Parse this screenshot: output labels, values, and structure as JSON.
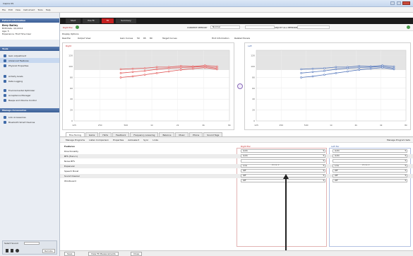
{
  "window": {
    "title": "Inspire OS"
  },
  "menu": [
    "File",
    "Edit",
    "View",
    "Instrument",
    "Tools",
    "Help"
  ],
  "sidebar": {
    "patient_header": "Patient Information",
    "patient_name": "Brey Bailey",
    "patient_lines": [
      "Birthdate: 4/1/2014",
      "Age: 5",
      "Experience: First Time User"
    ],
    "tools_header": "Tools",
    "tools": [
      "Gain Adjustment",
      "Advanced Features",
      "Physical Properties",
      "Activity Goals",
      "Data Logging",
      "Environmental Optimizer",
      "Acceptance Manager",
      "Beeps and Volume Control"
    ],
    "active_tool_index": 1,
    "manage_header": "Manage Accessories",
    "manage": [
      "Link Accessories",
      "Bluetooth Smart Devices"
    ],
    "footer_status": "Select Sound",
    "footer_badge": "Remote"
  },
  "topnav": {
    "tabs": [
      "Start",
      "Pre-Fit",
      "Fit",
      "Summary"
    ],
    "active_index": 2
  },
  "toolbar": {
    "label_left": "Right Ear",
    "label_mid": "CURRENT MEMORY",
    "memory_value": "Normal",
    "label_right": "ADJUST ALL MEMORIES",
    "row2": [
      "Display Options",
      "Real Ear",
      "Output View"
    ],
    "row3": [
      "Gain Curves",
      "50",
      "65",
      "80",
      "Target Curves",
      "Hint Information",
      "Related Panels"
    ]
  },
  "charts": {
    "right": {
      "ear": "right",
      "color": "#e05555",
      "toggle": "Right"
    },
    "left": {
      "ear": "left",
      "color": "#5577bb",
      "toggle": "Left"
    },
    "y_ticks": [
      "120",
      "100",
      "80",
      "60",
      "40",
      "20",
      "0"
    ],
    "x_ticks": [
      "125",
      "250",
      "500",
      "1k",
      "2k",
      "4k",
      "8k"
    ]
  },
  "chart_data": {
    "type": "line",
    "x": [
      "250",
      "500",
      "750",
      "1k",
      "1.5k",
      "2k",
      "3k",
      "4k",
      "6k"
    ],
    "series": [
      {
        "ear": "right",
        "values": [
          95,
          96,
          97,
          99,
          99,
          101,
          100,
          102,
          100
        ]
      },
      {
        "ear": "right",
        "values": [
          88,
          90,
          92,
          95,
          97,
          98,
          99,
          100,
          97
        ]
      },
      {
        "ear": "right",
        "values": [
          80,
          82,
          85,
          88,
          91,
          94,
          96,
          98,
          95
        ]
      },
      {
        "ear": "left",
        "values": [
          95,
          96,
          97,
          99,
          99,
          101,
          100,
          102,
          100
        ]
      },
      {
        "ear": "left",
        "values": [
          88,
          90,
          92,
          95,
          97,
          98,
          99,
          100,
          97
        ]
      },
      {
        "ear": "left",
        "values": [
          80,
          82,
          85,
          88,
          91,
          94,
          96,
          98,
          95
        ]
      }
    ],
    "ylim": [
      0,
      130
    ]
  },
  "feature_tabs": [
    "Fine Tuning",
    "Gains",
    "Hints",
    "Feedback",
    "Frequency Lowering",
    "Balance",
    "Music",
    "Phone",
    "Sound Tags"
  ],
  "feature_tabs_active": 0,
  "sub_tabs": [
    "Manage Programs",
    "Listen Comparison",
    "Properties",
    "Autoselect",
    "Sync",
    "Links"
  ],
  "sub_tabs_right": "Manage Program Sets",
  "features": {
    "header": "Features",
    "right_header": "Right Ear",
    "left_header": "Left Ear",
    "right_zone": "Zone 2",
    "left_zone": "Zone 2",
    "rows": [
      {
        "name": "Directionality",
        "right": "Auto",
        "left": "Auto"
      },
      {
        "name": "BFS (Tiers 1)",
        "right": "Auto",
        "left": "Auto"
      },
      {
        "name": "Noise BFS",
        "right": "",
        "left": ""
      },
      {
        "name": "Expansion",
        "right": "Low",
        "left": "Low"
      },
      {
        "name": "Speech Boost",
        "right": "Off",
        "left": "Off"
      },
      {
        "name": "Sound Cleaner",
        "right": "Off",
        "left": "Off"
      },
      {
        "name": "WindGuard",
        "right": "Off",
        "left": "Off"
      }
    ]
  },
  "bottom": {
    "button_left": "Save",
    "button_mid": "View Fit Measurements",
    "button_right": "Close"
  }
}
